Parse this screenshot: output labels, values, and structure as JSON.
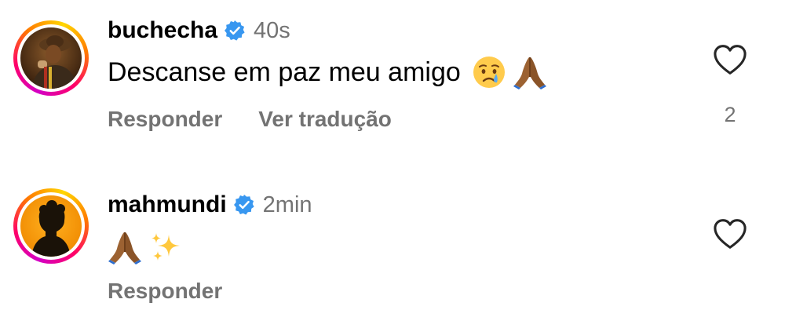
{
  "colors": {
    "verified_badge": "#3897f0",
    "secondary_text": "#737373",
    "primary_text": "#000000",
    "story_ring": "#ff0069"
  },
  "comments": [
    {
      "username": "buchecha",
      "verified": true,
      "time": "40s",
      "text": "Descanse em paz meu amigo",
      "emojis": [
        "crying-face-emoji",
        "folded-hands-emoji"
      ],
      "actions": {
        "reply": "Responder",
        "translate": "Ver tradução"
      },
      "like_count": "2",
      "icons": {
        "like": "heart-outline-icon",
        "badge": "verified-badge-icon"
      }
    },
    {
      "username": "mahmundi",
      "verified": true,
      "time": "2min",
      "text": "",
      "emojis": [
        "folded-hands-emoji",
        "sparkles-emoji"
      ],
      "actions": {
        "reply": "Responder"
      },
      "icons": {
        "like": "heart-outline-icon",
        "badge": "verified-badge-icon"
      }
    }
  ]
}
